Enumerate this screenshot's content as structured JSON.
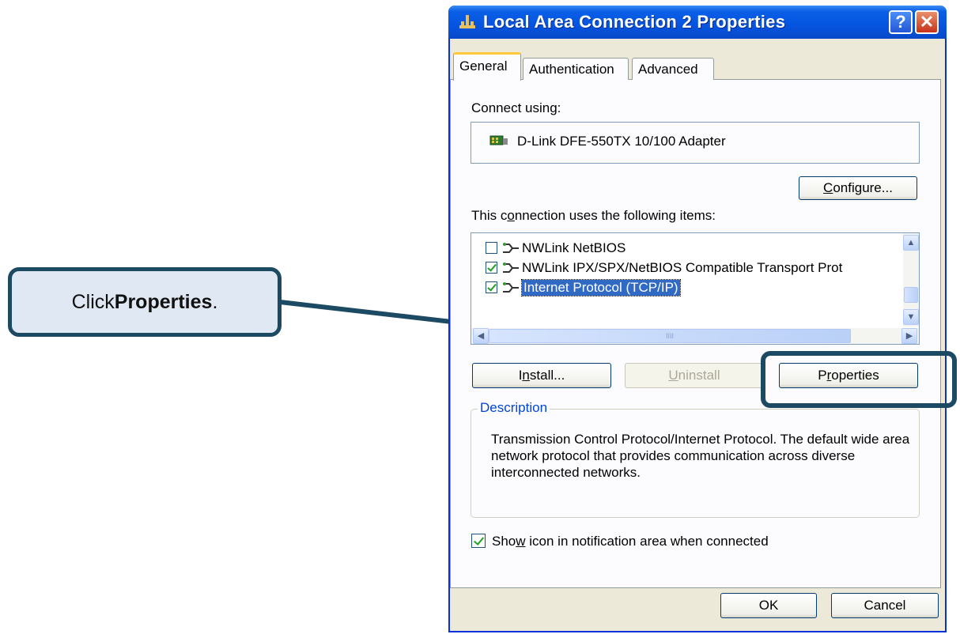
{
  "callout": {
    "prefix": "Click ",
    "bold": "Properties",
    "suffix": "."
  },
  "window": {
    "title": "Local Area Connection 2 Properties",
    "help_label": "?",
    "close_label": "✕"
  },
  "tabs": [
    {
      "label": "General",
      "active": true
    },
    {
      "label": "Authentication",
      "active": false
    },
    {
      "label": "Advanced",
      "active": false
    }
  ],
  "general": {
    "connect_using_label": "Connect using:",
    "adapter_name": "D-Link DFE-550TX 10/100 Adapter",
    "configure_button": {
      "pre": "",
      "u": "C",
      "post": "onfigure..."
    },
    "items_label": {
      "pre": "This c",
      "u": "o",
      "post": "nnection uses the following items:"
    },
    "items": [
      {
        "label": "NWLink NetBIOS",
        "checked": false,
        "selected": false
      },
      {
        "label": "NWLink IPX/SPX/NetBIOS Compatible Transport Prot",
        "checked": true,
        "selected": false
      },
      {
        "label": "Internet Protocol (TCP/IP)",
        "checked": true,
        "selected": true
      }
    ],
    "hscroll_grip": "IIII",
    "install_button": {
      "pre": "I",
      "u": "n",
      "post": "stall..."
    },
    "uninstall_button": {
      "pre": "",
      "u": "U",
      "post": "ninstall"
    },
    "properties_button": {
      "pre": "P",
      "u": "r",
      "post": "operties"
    },
    "description": {
      "legend": "Description",
      "text": "Transmission Control Protocol/Internet Protocol. The default wide area network protocol that provides communication across diverse interconnected networks."
    },
    "show_icon": {
      "pre": "Sho",
      "u": "w",
      "post": " icon in notification area when connected",
      "checked": true
    }
  },
  "footer": {
    "ok_label": "OK",
    "cancel_label": "Cancel"
  }
}
